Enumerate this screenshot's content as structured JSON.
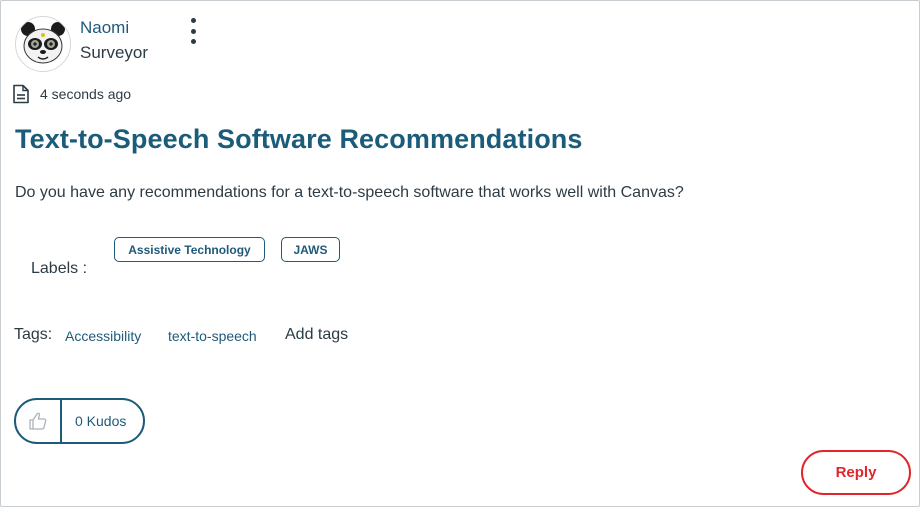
{
  "author": {
    "name": "Naomi",
    "rank": "Surveyor",
    "avatar_icon": "panda-avatar"
  },
  "post": {
    "timestamp": "4 seconds ago",
    "title": "Text-to-Speech Software Recommendations",
    "body": "Do you have any recommendations for a text-to-speech software that works well with Canvas?"
  },
  "labels": {
    "caption": "Labels :",
    "items": [
      "Assistive Technology",
      "JAWS"
    ]
  },
  "tags": {
    "caption": "Tags:",
    "items": [
      "Accessibility",
      "text-to-speech"
    ],
    "add_label": "Add tags"
  },
  "kudos": {
    "count_label": "0 Kudos",
    "icon": "thumbs-up-icon"
  },
  "actions": {
    "reply_label": "Reply"
  },
  "colors": {
    "title": "#1b5c7a",
    "link": "#1f5a7a",
    "reply": "#e0252d",
    "text": "#2d3b45"
  }
}
